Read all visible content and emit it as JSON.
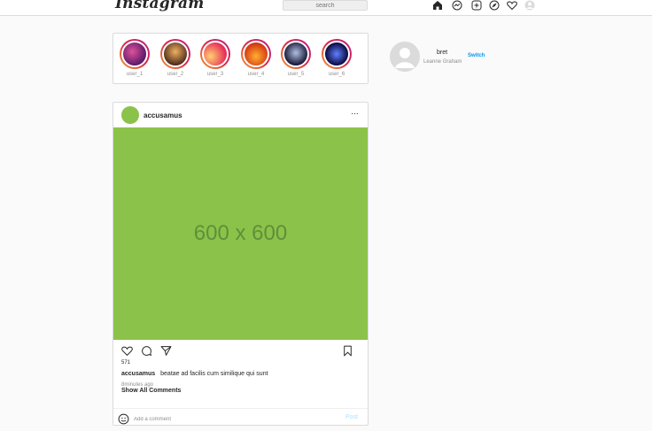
{
  "nav": {
    "logo": "Instagram",
    "search_placeholder": "search",
    "icons": [
      "home-icon",
      "messenger-icon",
      "new-post-icon",
      "explore-icon",
      "activity-heart-icon",
      "profile-avatar-icon"
    ]
  },
  "stories": [
    {
      "label": "user_1"
    },
    {
      "label": "user_2"
    },
    {
      "label": "user_3"
    },
    {
      "label": "user_4"
    },
    {
      "label": "user_5"
    },
    {
      "label": "user_6"
    }
  ],
  "sidebar": {
    "username": "bret",
    "name": "Leanne Graham",
    "switch_label": "Switch"
  },
  "post": {
    "username": "accusamus",
    "more_label": "···",
    "image_placeholder": "600 x 600",
    "likes": "571",
    "caption_user": "accusamus",
    "caption_text": "beatae ad facilis cum similique qui sunt",
    "time": "8minutes ago",
    "show_all": "Show All Comments",
    "comment_placeholder": "Add a comment",
    "post_button": "Post"
  },
  "colors": {
    "accent": "#0095f6",
    "post_button_disabled": "#b2dffc",
    "image_placeholder_bg": "#8bc34a"
  }
}
